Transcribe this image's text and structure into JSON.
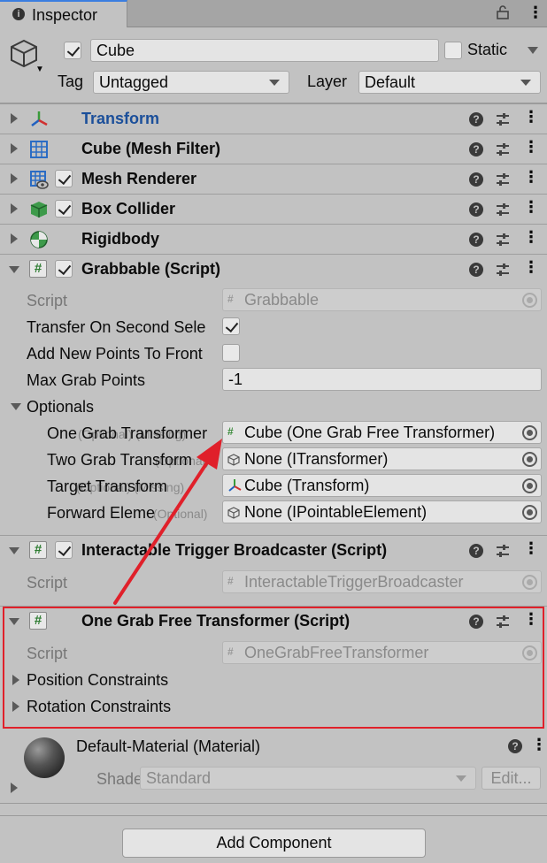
{
  "window": {
    "tab_title": "Inspector",
    "icon": "info-icon",
    "lock_icon": "lock-icon",
    "menu_icon": "kebab-icon"
  },
  "header": {
    "object_icon": "cube-icon",
    "active": true,
    "name": "Cube",
    "static_label": "Static",
    "static": false,
    "tag_label": "Tag",
    "tag_value": "Untagged",
    "layer_label": "Layer",
    "layer_value": "Default"
  },
  "components": [
    {
      "name": "Transform",
      "icon": "transform-icon"
    },
    {
      "name": "Cube (Mesh Filter)",
      "icon": "mesh-filter-icon"
    },
    {
      "name": "Mesh Renderer",
      "icon": "mesh-renderer-icon",
      "enabled": true
    },
    {
      "name": "Box Collider",
      "icon": "box-collider-icon",
      "enabled": true
    },
    {
      "name": "Rigidbody",
      "icon": "rigidbody-icon"
    },
    {
      "name": "Grabbable (Script)",
      "icon": "script-icon",
      "enabled": true,
      "expanded": true
    },
    {
      "name": "Interactable Trigger Broadcaster (Script)",
      "icon": "script-icon",
      "enabled": true,
      "expanded": true
    },
    {
      "name": "One Grab Free Transformer (Script)",
      "icon": "script-icon",
      "expanded": true
    }
  ],
  "grabbable": {
    "script_label": "Script",
    "script_value": "Grabbable",
    "transfer_label": "Transfer On Second Sele",
    "transfer_value": true,
    "add_points_label": "Add New Points To Front",
    "add_points_value": false,
    "max_points_label": "Max Grab Points",
    "max_points_value": "-1",
    "optionals_label": "Optionals",
    "one_grab_label": "One Grab Transformer",
    "one_grab_overlap": "(Optional) (Missing)",
    "one_grab_value": "Cube (One Grab Free Transformer)",
    "two_grab_label": "Two Grab Transform",
    "two_grab_overlap": "(Optional)",
    "two_grab_value": "None (ITransformer)",
    "target_label": "Target Transform",
    "target_overlap": "(Optional) (Missing)",
    "target_value": "Cube (Transform)",
    "forward_label": "Forward Eleme",
    "forward_overlap": "(Optional)",
    "forward_value": "None (IPointableElement)"
  },
  "broadcaster": {
    "script_label": "Script",
    "script_value": "InteractableTriggerBroadcaster"
  },
  "one_grab_free": {
    "script_label": "Script",
    "script_value": "OneGrabFreeTransformer",
    "position_label": "Position Constraints",
    "rotation_label": "Rotation Constraints"
  },
  "material": {
    "name": "Default-Material (Material)",
    "shader_label": "Shader",
    "shader_value": "Standard",
    "edit_label": "Edit..."
  },
  "add_component_label": "Add Component",
  "annotation": {
    "highlight_color": "#e0202a",
    "arrow_color": "#e0202a"
  }
}
